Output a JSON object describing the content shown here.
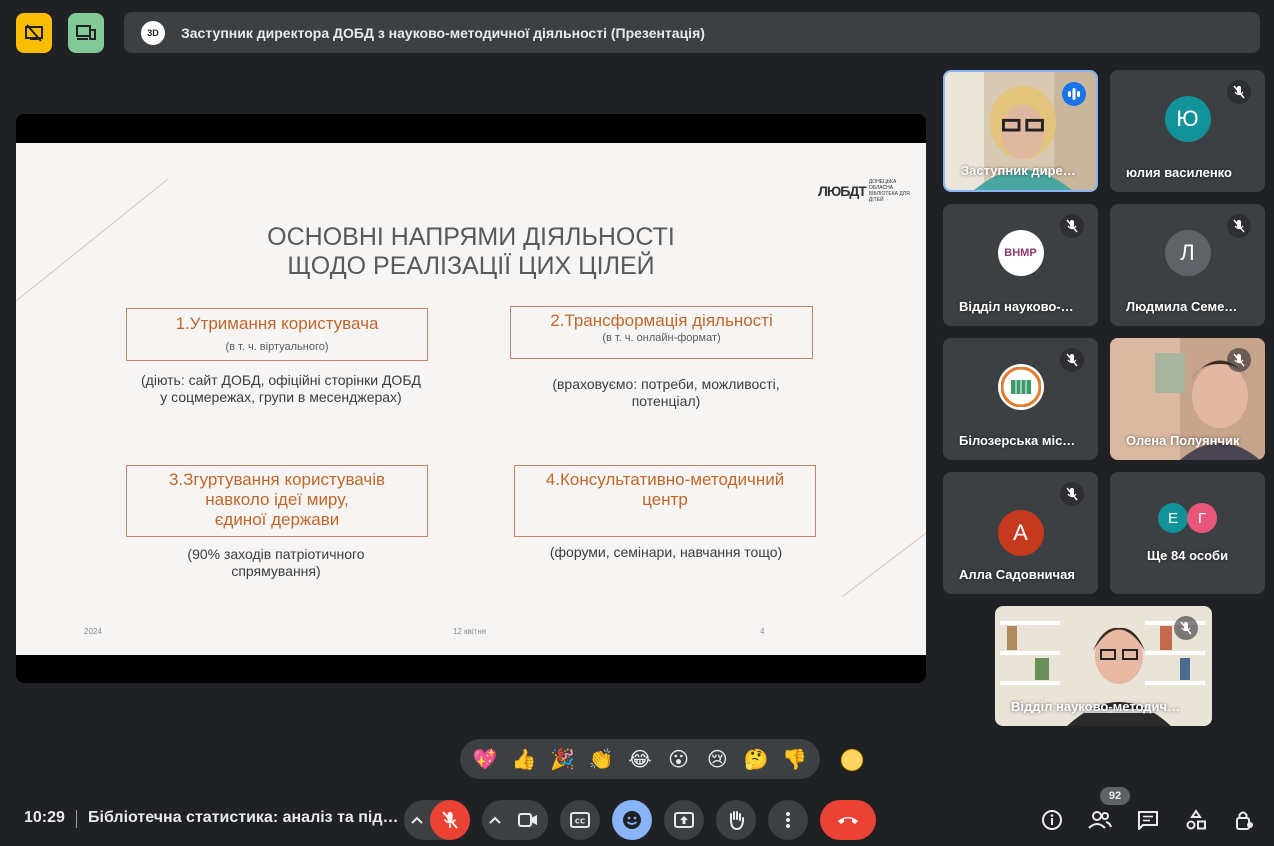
{
  "meeting_title": "Заступник директора ДОБД з науково-методичної діяльності (Презентація)",
  "title_logo_text": "3D",
  "slide": {
    "title_line1": "ОСНОВНІ НАПРЯМИ ДІЯЛЬНОСТІ",
    "title_line2": "ЩОДО РЕАЛІЗАЦІЇ ЦИХ ЦІЛЕЙ",
    "logo_mark": "ЛЮБДТ",
    "logo_text": "ДОНЕЦЬКА ОБЛАСНА БІБЛІОТЕКА ДЛЯ ДІТЕЙ",
    "box1_title": "1.Утримання користувача",
    "box1_sub": "(в т. ч. віртуального)",
    "note1": "(діють: сайт ДОБД, офіційні сторінки ДОБД у соцмережах, групи в месенджерах)",
    "box2_title": "2.Трансформація  діяльності",
    "box2_sub": "(в т. ч.  онлайн-формат)",
    "note2": "(враховуємо: потреби, можливості, потенціал)",
    "box3_line1": "3.Згуртування  користувачів",
    "box3_line2": "навколо ідеї миру,",
    "box3_line3": "єдиної держави",
    "note3": "(90% заходів патріотичного спрямування)",
    "box4_line1": "4.Консультативно-методичний",
    "box4_line2": "центр",
    "note4": "(форуми, семінари, навчання тощо)",
    "footer_year": "2024",
    "footer_date": "12 квітня",
    "footer_page": "4"
  },
  "participants": [
    {
      "name": "Заступник дире…",
      "kind": "video",
      "speaking": true
    },
    {
      "name": "юлия василенко",
      "initial": "Ю",
      "color": "#12939a",
      "muted": true
    },
    {
      "name": "Відділ науково-…",
      "initial": "ВНМР",
      "color": "#ffffff",
      "muted": true
    },
    {
      "name": "Людмила Семе…",
      "initial": "Л",
      "color": "#5f6368",
      "muted": true
    },
    {
      "name": "Білозерська міс…",
      "initial": "",
      "color": "#ffffff",
      "muted": true
    },
    {
      "name": "Олена Полуянчик",
      "kind": "video",
      "muted": true
    },
    {
      "name": "Алла Садовничая",
      "initial": "А",
      "color": "#c5391e",
      "muted": true
    },
    {
      "name": "Ще 84 особи",
      "initial_a": "Е",
      "initial_b": "Г",
      "color_a": "#12939a",
      "color_b": "#e8567c"
    }
  ],
  "self_view": {
    "name": "Відділ науково-методич…"
  },
  "reactions": [
    "💖",
    "👍",
    "🎉",
    "👏",
    "😂",
    "😮",
    "😢",
    "🤔",
    "👎"
  ],
  "bottom_bar": {
    "time": "10:29",
    "meeting_name": "Бібліотечна статистика: аналіз та під…",
    "participant_count": "92"
  },
  "colors": {
    "background": "#202124",
    "tile": "#3c4043",
    "accent_blue": "#8ab4f8",
    "danger_red": "#ea4335",
    "slide_accent": "#c0672b"
  }
}
